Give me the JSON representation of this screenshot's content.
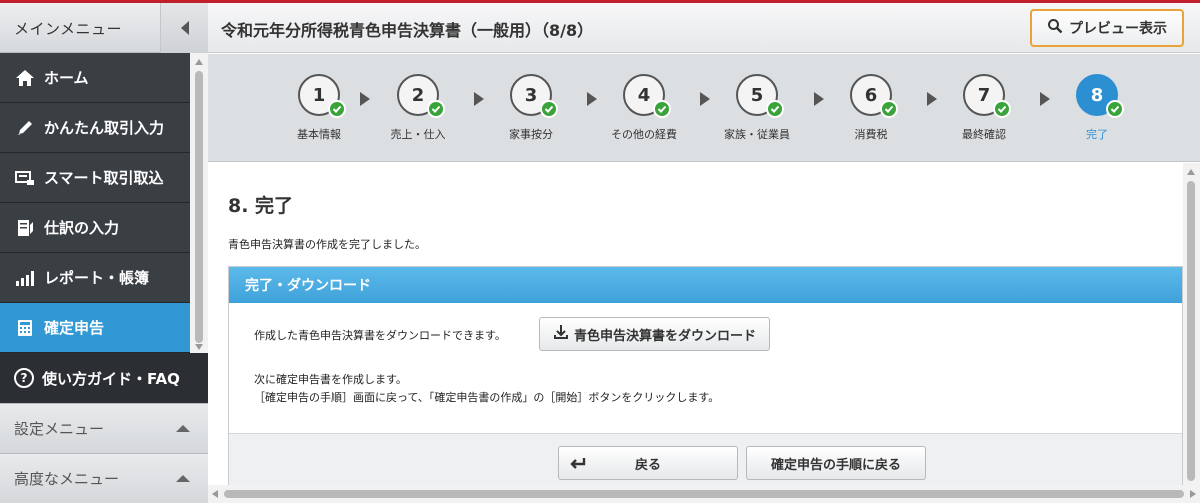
{
  "sidebar": {
    "title": "メインメニュー",
    "items": [
      {
        "label": "ホーム",
        "icon": "home-icon"
      },
      {
        "label": "かんたん取引入力",
        "icon": "pencil-icon"
      },
      {
        "label": "スマート取引取込",
        "icon": "import-icon"
      },
      {
        "label": "仕訳の入力",
        "icon": "journal-icon"
      },
      {
        "label": "レポート・帳簿",
        "icon": "chart-icon"
      },
      {
        "label": "確定申告",
        "icon": "calculator-icon",
        "active": true
      }
    ],
    "guide": {
      "label": "使い方ガイド・FAQ",
      "icon_glyph": "?"
    },
    "settings_menu": "設定メニュー",
    "advanced_menu": "高度なメニュー"
  },
  "header": {
    "title": "令和元年分所得税青色申告決算書（一般用）（8/8）",
    "preview_label": "プレビュー表示"
  },
  "steps": [
    {
      "num": "1",
      "label": "基本情報",
      "done": true
    },
    {
      "num": "2",
      "label": "売上・仕入",
      "done": true
    },
    {
      "num": "3",
      "label": "家事按分",
      "done": true
    },
    {
      "num": "4",
      "label": "その他の経費",
      "done": true
    },
    {
      "num": "5",
      "label": "家族・従業員",
      "done": true
    },
    {
      "num": "6",
      "label": "消費税",
      "done": true
    },
    {
      "num": "7",
      "label": "最終確認",
      "done": true
    },
    {
      "num": "8",
      "label": "完了",
      "done": true,
      "current": true
    }
  ],
  "main": {
    "section_title": "8.  完了",
    "intro": "青色申告決算書の作成を完了しました。",
    "panel": {
      "title": "完了・ダウンロード",
      "download_text": "作成した青色申告決算書をダウンロードできます。",
      "download_button": "青色申告決算書をダウンロード",
      "next_line1": "次に確定申告書を作成します。",
      "next_line2": "［確定申告の手順］画面に戻って、「確定申告書の作成」の［開始］ボタンをクリックします。",
      "back_button": "戻る",
      "procedure_button": "確定申告の手順に戻る"
    }
  },
  "colors": {
    "accent": "#3298d4",
    "sidebar_bg": "#3a3f44",
    "preview_border": "#e9a33a",
    "check_green": "#3aa33a",
    "top_line": "#c01f2b"
  }
}
